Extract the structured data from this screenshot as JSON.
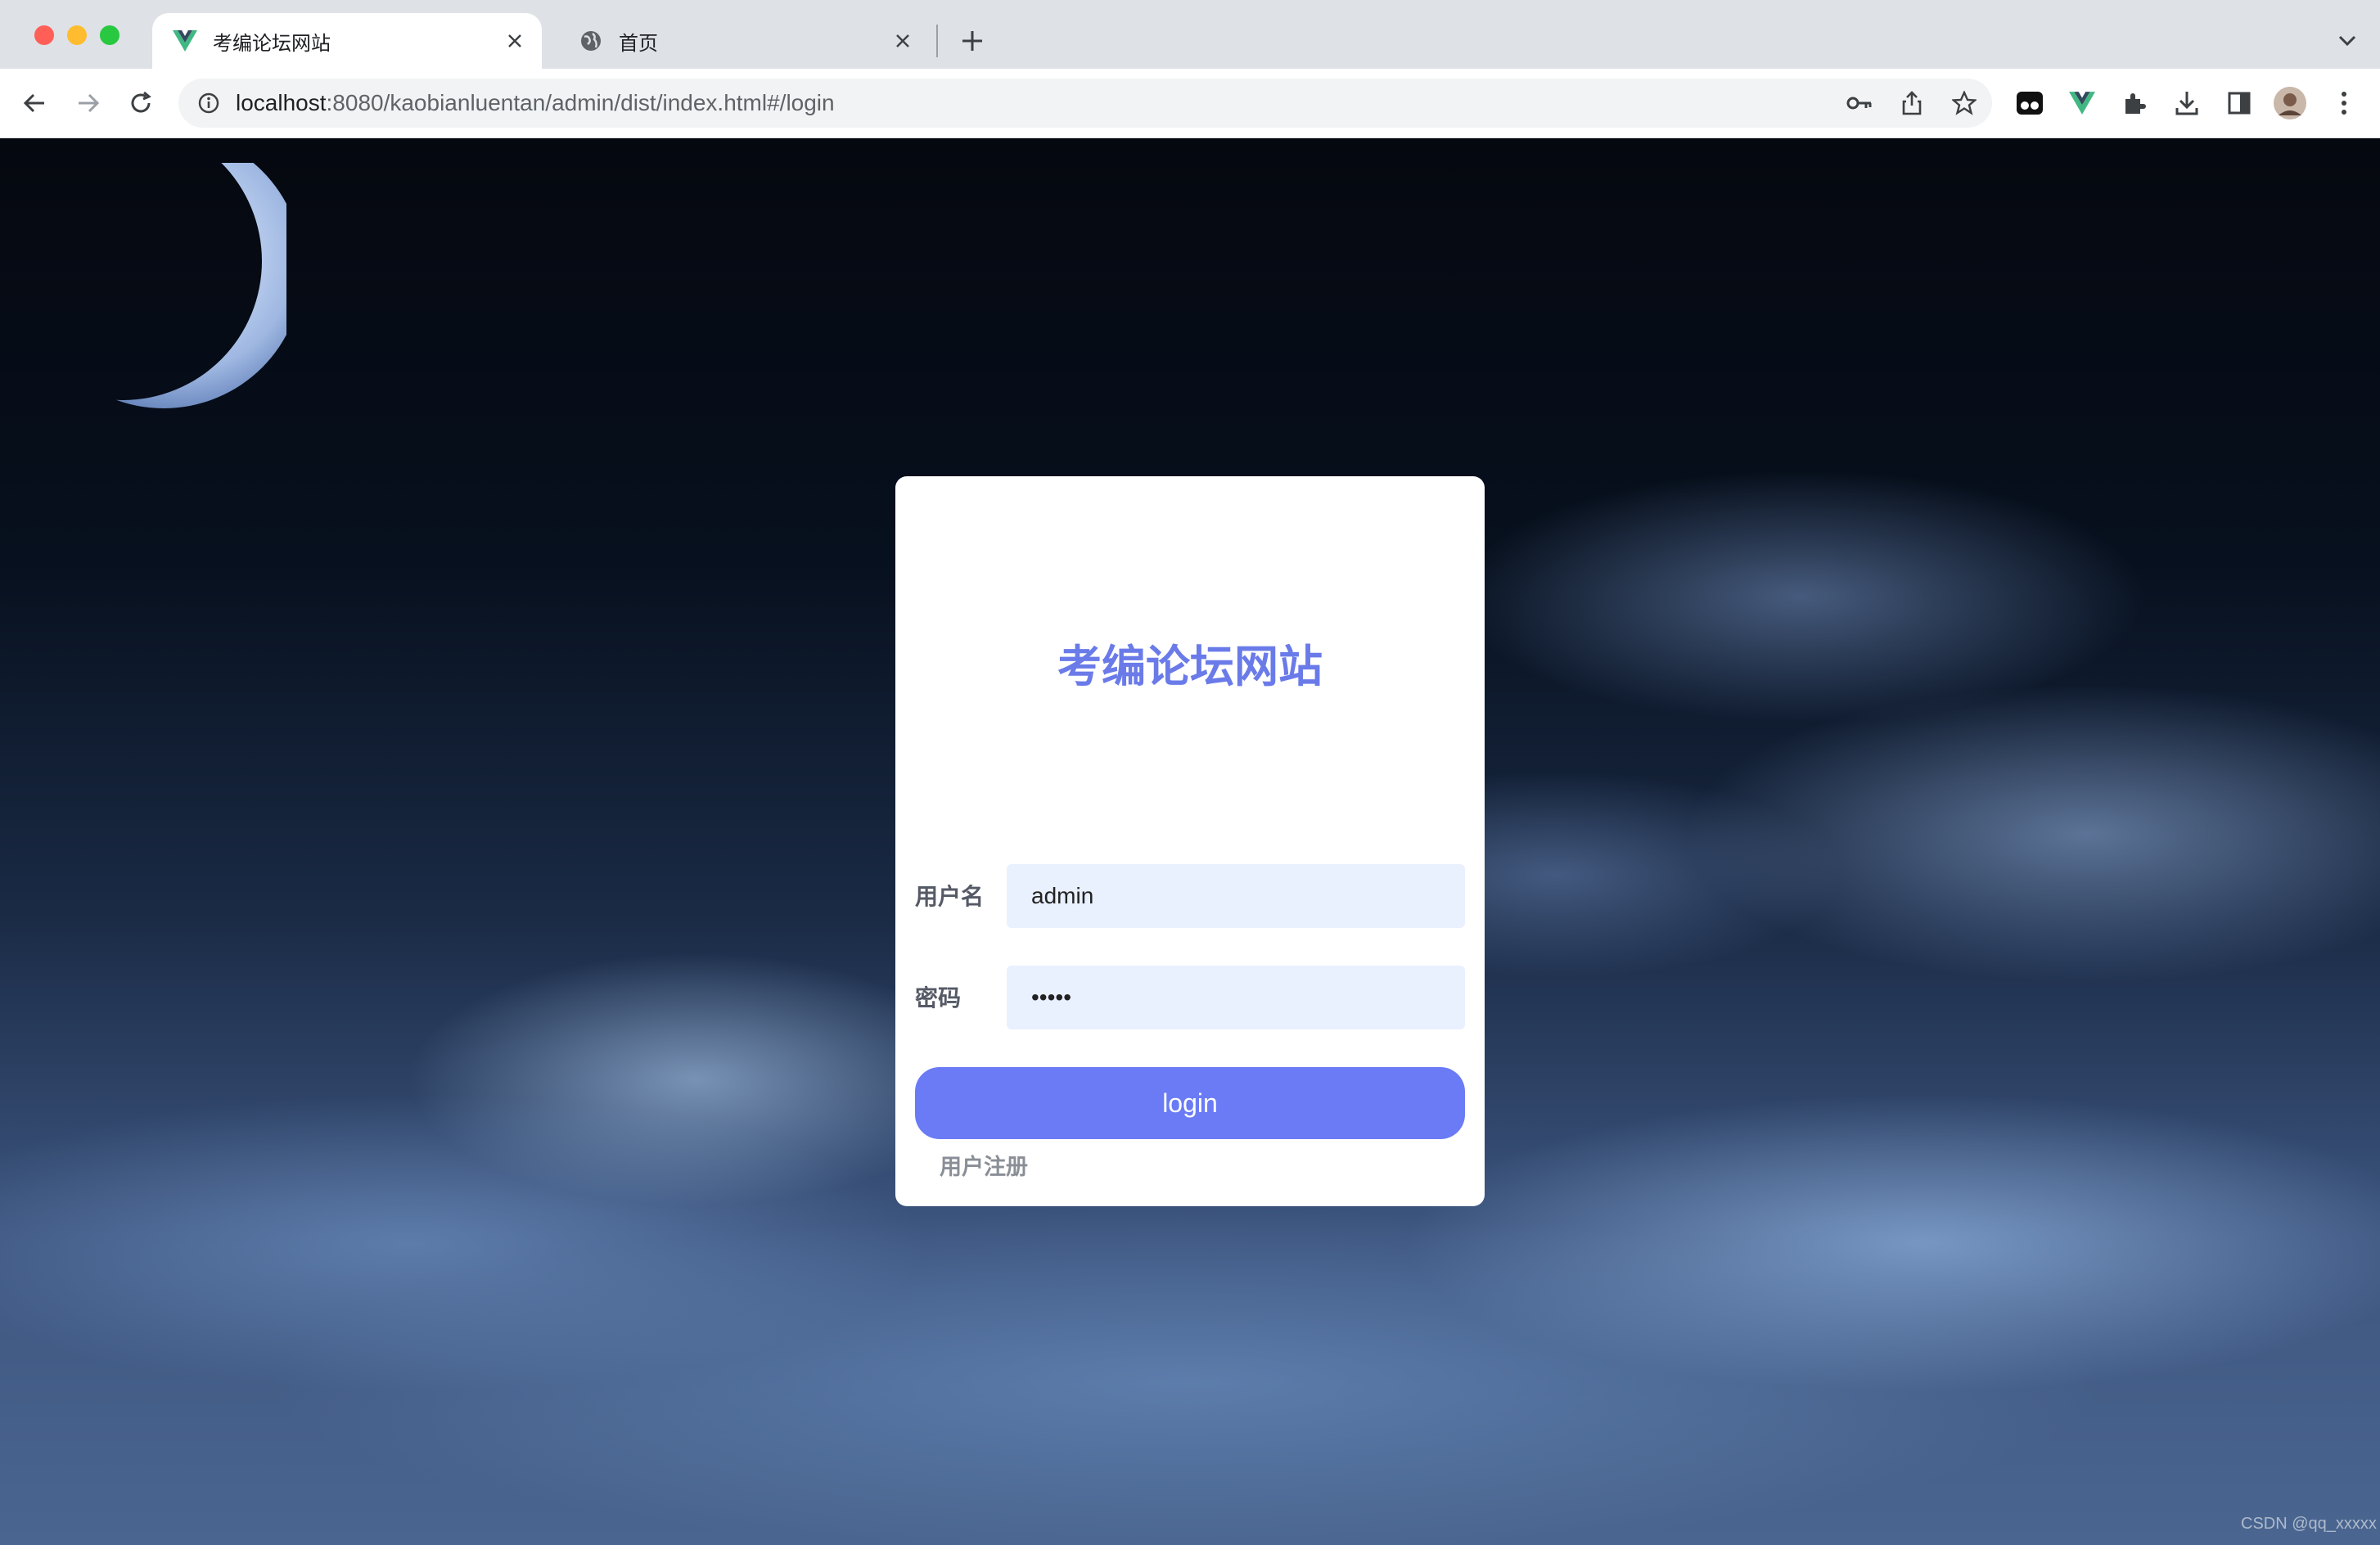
{
  "browser": {
    "tabs": [
      {
        "title": "考编论坛网站",
        "favicon": "vue-logo-icon",
        "active": true
      },
      {
        "title": "首页",
        "favicon": "globe-icon",
        "active": false
      }
    ],
    "url_host": "localhost",
    "url_rest": ":8080/kaobianluentan/admin/dist/index.html#/login"
  },
  "login": {
    "title": "考编论坛网站",
    "username_label": "用户名",
    "username_value": "admin",
    "password_label": "密码",
    "password_value": "•••••",
    "login_button": "login",
    "register_link": "用户注册"
  },
  "watermark": "CSDN @qq_xxxxx",
  "colors": {
    "accent": "#6a7bf5",
    "title": "#6a7be9",
    "input_bg": "#e9f0fe"
  }
}
